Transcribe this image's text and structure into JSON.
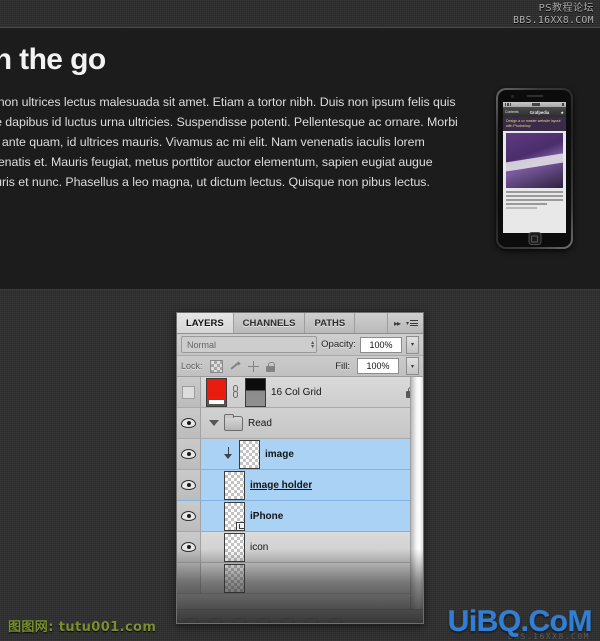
{
  "watermarks": {
    "top_right_line1": "PS教程论坛",
    "top_right_line2": "BBS.16XX8.COM",
    "bottom_left": "图图网: tutu001.com",
    "bottom_right": "UiBQ.CoM",
    "bottom_right_sub": "BBS.16XX8.COM"
  },
  "article": {
    "headline": "on the go",
    "body": "rci, non ultrices lectus malesuada sit amet. Etiam a tortor nibh. Duis non ipsum felis quis ante dapibus id luctus urna ultricies. Suspendisse potenti. Pellentesque ac ornare. Morbi non ante quam, id ultrices mauris. Vivamus ac mi elit. Nam venenatis iaculis lorem venenatis et. Mauris feugiat, metus porttitor auctor elementum, sapien eugiat augue mauris et nunc. Phasellus a leo magna, ut dictum lectus. Quisque non pibus lectus."
  },
  "phone": {
    "app_title": "Grafpedia",
    "back_label": "Contents",
    "star_glyph": "★",
    "article_heading": "Design a cv master website layout with Photoshop"
  },
  "panel": {
    "tabs": [
      {
        "label": "LAYERS",
        "active": true
      },
      {
        "label": "CHANNELS",
        "active": false
      },
      {
        "label": "PATHS",
        "active": false
      }
    ],
    "collapse_glyph": "▸▸",
    "menu_icon": "panel-menu-icon",
    "blend_mode": "Normal",
    "opacity_label": "Opacity:",
    "opacity_value": "100%",
    "lock_label": "Lock:",
    "lock_icons": [
      "lock-transparency-icon",
      "lock-brush-icon",
      "lock-move-icon",
      "lock-all-icon"
    ],
    "fill_label": "Fill:",
    "fill_value": "100%",
    "layers": [
      {
        "name": "16 Col Grid",
        "visible": false,
        "selected": false,
        "kind": "color-fill-with-mask",
        "locked": true,
        "linked": true,
        "indent": 0
      },
      {
        "name": "Read",
        "visible": true,
        "selected": false,
        "kind": "group",
        "expanded": true,
        "locked": false,
        "indent": 0
      },
      {
        "name": "image",
        "visible": true,
        "selected": true,
        "kind": "clipped-layer",
        "locked": false,
        "indent": 1
      },
      {
        "name": "image holder",
        "visible": true,
        "selected": true,
        "kind": "layer",
        "underlined": true,
        "locked": false,
        "indent": 1
      },
      {
        "name": "iPhone",
        "visible": true,
        "selected": true,
        "kind": "smart-object",
        "locked": false,
        "indent": 1
      },
      {
        "name": "icon",
        "visible": true,
        "selected": false,
        "kind": "layer",
        "locked": false,
        "indent": 1
      }
    ]
  },
  "colors": {
    "page_background": "#1c1c1c",
    "panel_background": "#d4d4d4",
    "selection_blue": "#a9d2f4",
    "thumb_red": "#e81d10",
    "watermark_blue": "#2f7fd6",
    "watermark_green": "#7a8f2e"
  }
}
